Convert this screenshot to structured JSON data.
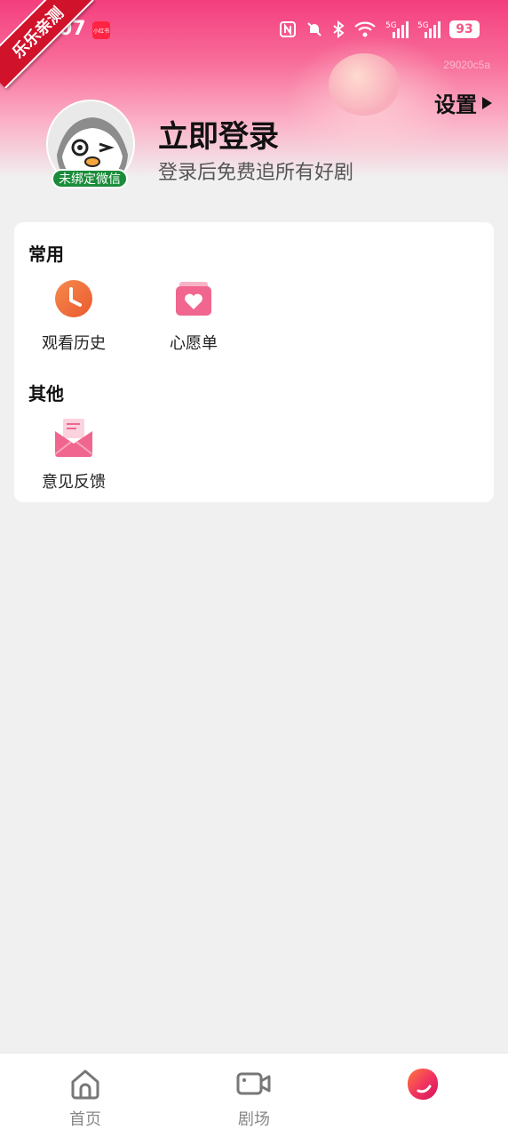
{
  "status_bar": {
    "time": "07",
    "app_badge": "小红书",
    "battery": "93"
  },
  "ribbon": {
    "text": "乐乐亲测"
  },
  "header": {
    "id_text": "29020c5a",
    "settings_label": "设置",
    "login_title": "立即登录",
    "login_subtitle": "登录后免费追所有好剧",
    "bind_badge": "未绑定微信"
  },
  "sections": [
    {
      "title": "常用",
      "items": [
        {
          "label": "观看历史",
          "icon": "clock-icon"
        },
        {
          "label": "心愿单",
          "icon": "wishlist-heart-icon"
        }
      ]
    },
    {
      "title": "其他",
      "items": [
        {
          "label": "意见反馈",
          "icon": "feedback-envelope-icon"
        }
      ]
    }
  ],
  "bottom_nav": {
    "items": [
      {
        "label": "首页",
        "icon": "home-icon"
      },
      {
        "label": "剧场",
        "icon": "video-camera-icon"
      },
      {
        "label": "",
        "icon": "profile-orb-icon"
      }
    ]
  },
  "colors": {
    "accent": "#f43e7e",
    "badge_green": "#1a8c3a",
    "clock_orange": "#ee6a3a",
    "pink_icon": "#f0668f"
  }
}
